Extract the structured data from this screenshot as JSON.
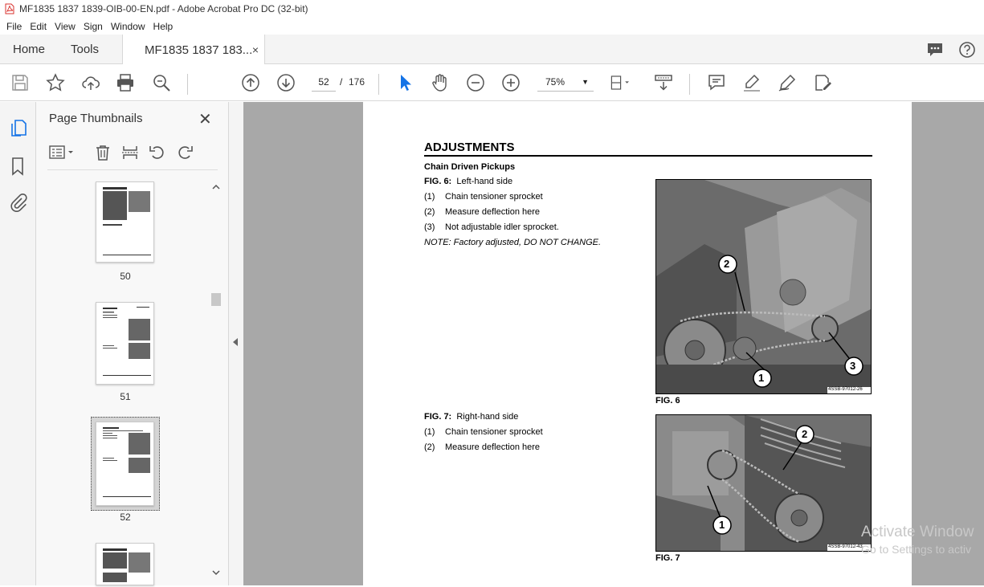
{
  "window": {
    "title": "MF1835 1837 1839-OIB-00-EN.pdf - Adobe Acrobat Pro DC (32-bit)"
  },
  "menu": [
    "File",
    "Edit",
    "View",
    "Sign",
    "Window",
    "Help"
  ],
  "tabs": {
    "home": "Home",
    "tools": "Tools",
    "doc": "MF1835 1837 183...",
    "close": "×"
  },
  "nav": {
    "current_page": "52",
    "separator": "/",
    "total_pages": "176",
    "zoom": "75%"
  },
  "panel": {
    "title": "Page Thumbnails",
    "thumbnails": [
      {
        "label": "50"
      },
      {
        "label": "51"
      },
      {
        "label": "52",
        "selected": true
      },
      {
        "label": ""
      }
    ]
  },
  "document": {
    "heading": "ADJUSTMENTS",
    "subheading": "Chain Driven Pickups",
    "fig6": {
      "title_bold": "FIG. 6:",
      "title": "Left-hand side",
      "items": [
        {
          "num": "(1)",
          "text": "Chain tensioner sprocket"
        },
        {
          "num": "(2)",
          "text": "Measure deflection here"
        },
        {
          "num": "(3)",
          "text": "Not adjustable idler sprocket."
        }
      ],
      "note": "NOTE:  Factory adjusted, DO NOT CHANGE.",
      "caption": "FIG. 6",
      "photo_code": "4SSB-97012-26",
      "callouts": [
        "1",
        "2",
        "3"
      ]
    },
    "fig7": {
      "title_bold": "FIG. 7:",
      "title": "Right-hand side",
      "items": [
        {
          "num": "(1)",
          "text": "Chain tensioner sprocket"
        },
        {
          "num": "(2)",
          "text": "Measure deflection here"
        }
      ],
      "caption": "FIG. 7",
      "photo_code": "4SSB-97012-43",
      "callouts": [
        "1",
        "2"
      ]
    }
  },
  "watermark": {
    "line1": "Activate Window",
    "line2": "Go to Settings to activ"
  },
  "colors": {
    "accent": "#1473e6",
    "toolbar_bg": "#f4f4f4",
    "viewer_bg": "#a8a8a8"
  }
}
